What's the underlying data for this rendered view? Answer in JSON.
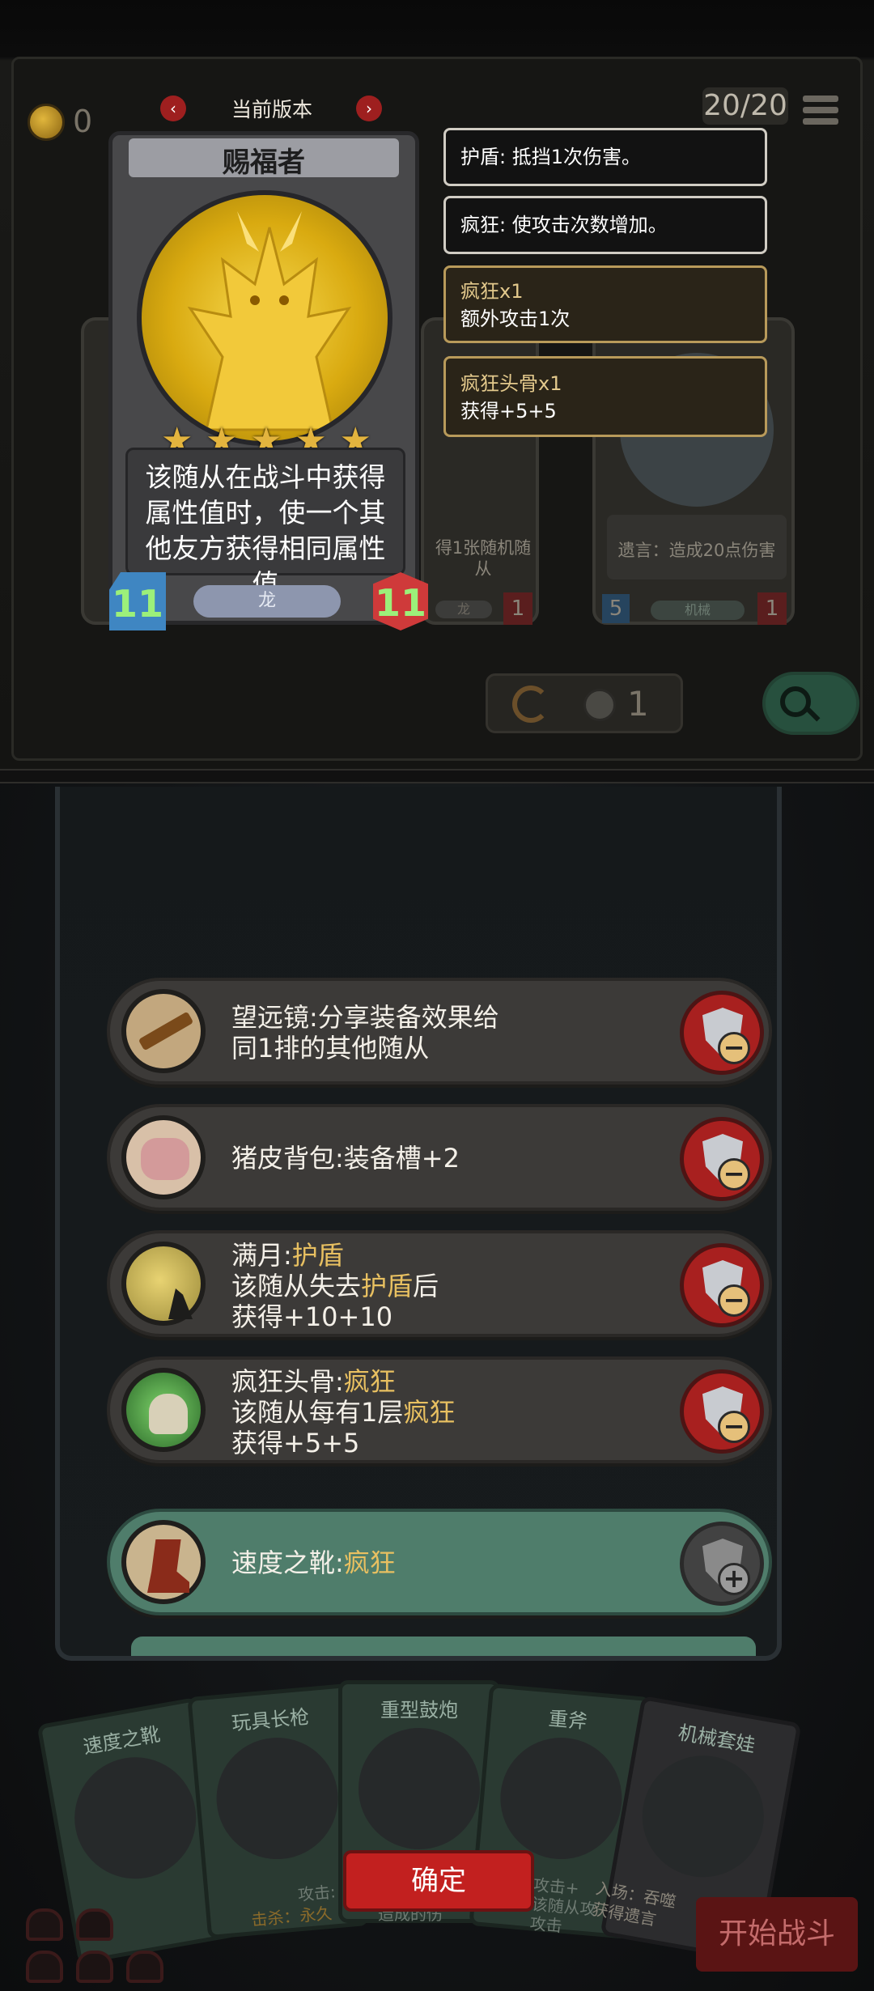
{
  "top": {
    "coins": "0",
    "counter": "20/20",
    "version_label": "当前版本",
    "version_prev": "‹",
    "version_next": "›"
  },
  "card": {
    "name": "赐福者",
    "stars": 5,
    "description": "该随从在战斗中获得属性值时，使一个其他友方获得相同属性值",
    "tribe": "龙",
    "attack": "11",
    "health": "11"
  },
  "tooltips": [
    {
      "line1": "护盾: 抵挡1次伤害。"
    },
    {
      "line1": "疯狂: 使攻击次数增加。"
    },
    {
      "line1": "疯狂x1",
      "line2": "额外攻击1次"
    },
    {
      "line1": "疯狂头骨x1",
      "line2": "获得+5+5"
    }
  ],
  "background_cards": {
    "middle_text": "得1张随机随从",
    "middle_tag": "龙",
    "right_text": "遗言：造成20点伤害",
    "right_tag": "机械",
    "right_attack": "5",
    "right_health": "1",
    "middle_health": "1"
  },
  "toolbar": {
    "refresh_count": "1"
  },
  "equipment": [
    {
      "name": "望远镜",
      "effect": "分享装备效果给",
      "effect2": "同1排的其他随从",
      "action": "remove",
      "icon": "telescope-icon"
    },
    {
      "name": "猪皮背包",
      "effect": "装备槽+2",
      "action": "remove",
      "icon": "pig-backpack-icon"
    },
    {
      "name": "满月",
      "keyword": "护盾",
      "line2a": "该随从失去",
      "line2k": "护盾",
      "line2b": "后",
      "line3": "获得+10+10",
      "action": "remove",
      "icon": "full-moon-icon"
    },
    {
      "name": "疯狂头骨",
      "keyword": "疯狂",
      "line2a": "该随从每有1层",
      "line2k": "疯狂",
      "line3": "获得+5+5",
      "action": "remove",
      "icon": "crazy-skull-icon"
    },
    {
      "name": "速度之靴",
      "keyword": "疯狂",
      "action": "add",
      "icon": "speed-boots-icon"
    }
  ],
  "hand_cards": [
    "速度之靴",
    "玩具长枪",
    "重型鼓炮",
    "重斧",
    "机械套娃"
  ],
  "hand_texts": {
    "c2_bottom": "攻击:",
    "c2_kill": "击杀：永久",
    "c3_bottom": "造成的伤",
    "c4_bottom1": "攻击+",
    "c4_bottom2": "该随从攻",
    "c4_bottom3": "攻击",
    "c5_bottom1": "入场：吞噬",
    "c5_bottom2": "获得遗言"
  },
  "buttons": {
    "confirm": "确定",
    "start_battle": "开始战斗"
  },
  "colors": {
    "accent_red": "#c2201f",
    "gold": "#e8c061",
    "green_row": "#4f7d6b"
  }
}
